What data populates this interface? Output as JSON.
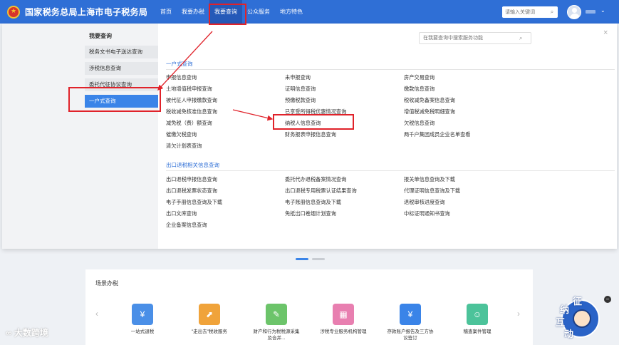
{
  "header": {
    "site_title": "国家税务总局上海市电子税务局",
    "nav": [
      "首页",
      "我要办税",
      "我要查询",
      "公众服务",
      "地方特色"
    ],
    "search_placeholder": "请输入关键词",
    "search_icon": "search-icon",
    "caret": "⌄"
  },
  "side": {
    "title": "我要查询",
    "items": [
      "税务文书电子送达查询",
      "涉税信息查询",
      "委托代征协议查询",
      "一户式查询"
    ]
  },
  "panel": {
    "search_placeholder": "在我要查询中搜索服务功能",
    "close": "×",
    "section1": {
      "title": "一户式查询",
      "links": [
        "申报信息查询",
        "未申报查询",
        "房产交易查询",
        "土地增值税申报查询",
        "证明信息查询",
        "缴款信息查询",
        "被代征人申报缴款查询",
        "预缴税款查询",
        "税收减免备案信息查询",
        "税收减免核准信息查询",
        "已享受所得税优惠情况查询",
        "增值税减免税明细查询",
        "减免税（费）额查询",
        "纳税人信息查询",
        "欠税信息查询",
        "催缴欠税查询",
        "财务报表申报信息查询",
        "两千户集团成员企业名单查看",
        "清欠计划表查询"
      ]
    },
    "section2": {
      "title": "出口退税相关信息查询",
      "links": [
        "出口退税申报信息查询",
        "委托代办退税备案情况查询",
        "报关单信息查询及下载",
        "出口退税发票状态查询",
        "出口退税专用税票认证结果查询",
        "代理证明信息查询及下载",
        "电子手册信息查询及下载",
        "电子账册信息查询及下载",
        "退税审核进度查询",
        "出口文库查询",
        "免抵出口卷烟计划查询",
        "中标证明通知书查询",
        "企业备案信息查询"
      ]
    }
  },
  "scene": {
    "title": "场景办税",
    "prev": "‹",
    "next": "›",
    "tiles": [
      {
        "label": "一站式退税",
        "color": "#4a8fe7",
        "icon": "¥"
      },
      {
        "label": "\"走出去\"税收服务",
        "color": "#f0a33a",
        "icon": "⬈"
      },
      {
        "label": "财产和行为税税源采集及合并...",
        "color": "#6cc46a",
        "icon": "✎"
      },
      {
        "label": "涉税专业服务机构管理",
        "color": "#e87fb0",
        "icon": "▦"
      },
      {
        "label": "存款账户报告及三方协议签订",
        "color": "#3a84e8",
        "icon": "¥"
      },
      {
        "label": "稽查案件管理",
        "color": "#4cc39a",
        "icon": "☺"
      }
    ]
  },
  "watermark": "大数跨境",
  "mascot": {
    "chars": [
      "征",
      "纳",
      "互",
      "动"
    ],
    "close": "−"
  }
}
